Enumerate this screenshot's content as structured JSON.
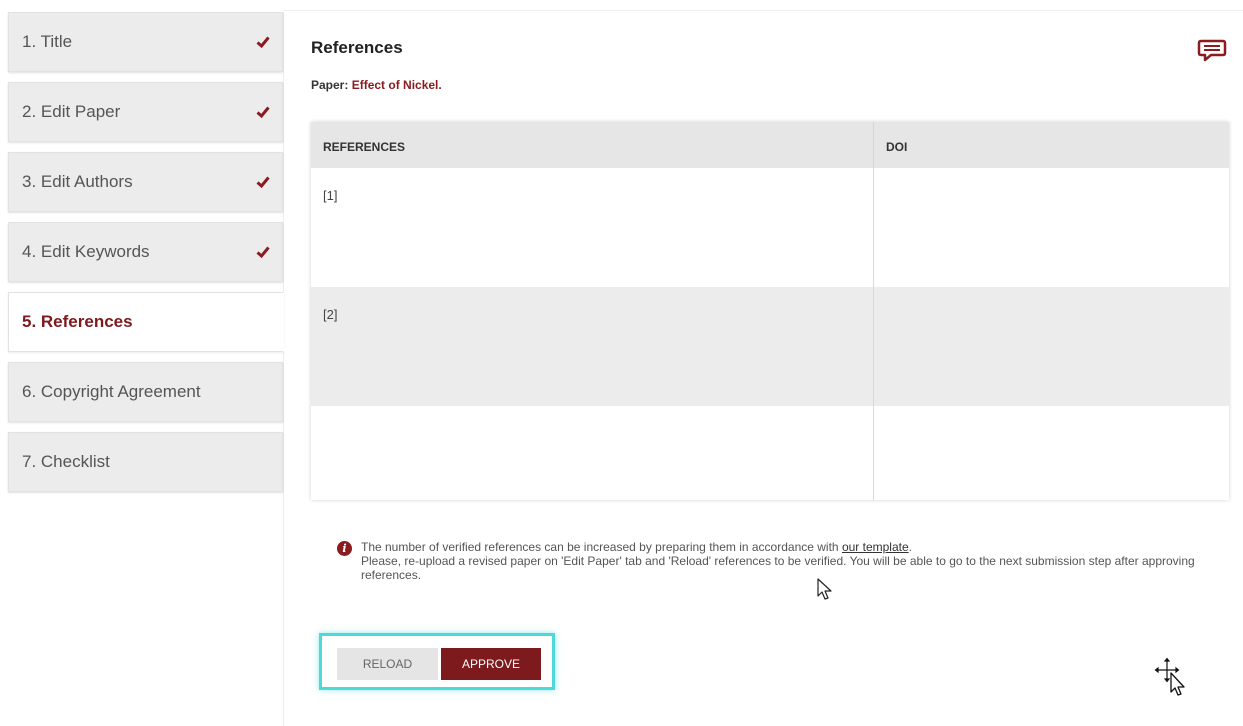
{
  "sidebar": {
    "steps": [
      {
        "label": "1. Title",
        "done": true
      },
      {
        "label": "2. Edit Paper",
        "done": true
      },
      {
        "label": "3. Edit Authors",
        "done": true
      },
      {
        "label": "4. Edit Keywords",
        "done": true
      },
      {
        "label": "5. References",
        "active": true
      },
      {
        "label": "6. Copyright Agreement"
      },
      {
        "label": "7. Checklist"
      }
    ]
  },
  "main": {
    "title": "References",
    "paper_label": "Paper:",
    "paper_name": "Effect of Nickel",
    "paper_suffix": ".",
    "table": {
      "headers": [
        "REFERENCES",
        "DOI"
      ],
      "rows": [
        {
          "ref": "[1]",
          "doi": ""
        },
        {
          "ref": "[2]",
          "doi": ""
        },
        {
          "ref": "",
          "doi": ""
        }
      ]
    },
    "notice": {
      "line1_prefix": "The number of verified references can be increased by preparing them in accordance with",
      "link": "our template",
      "line1_suffix": ".",
      "line2": "Please, re-upload a revised paper on 'Edit Paper' tab and 'Reload' references to be verified. You will be able to go to the next submission step after approving references."
    },
    "buttons": {
      "reload": "RELOAD",
      "approve": "APPROVE"
    }
  },
  "colors": {
    "accent": "#7d1a1e",
    "highlight_frame": "#4fd8d8"
  },
  "icons": {
    "comment": "comment-icon",
    "check": "checkmark-icon",
    "info": "info-icon"
  }
}
